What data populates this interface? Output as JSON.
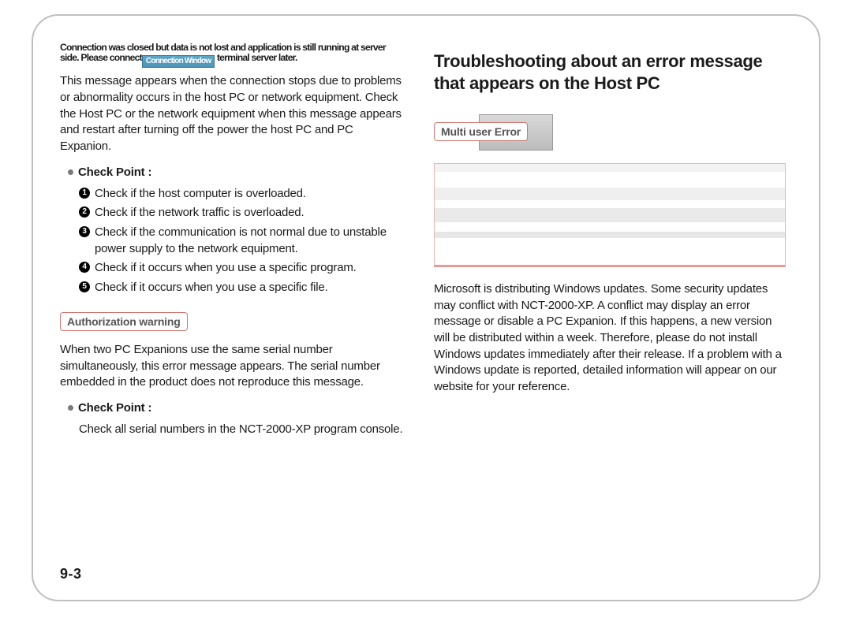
{
  "left": {
    "banner_text_a": "Connection was closed but data is not lost and application is still running at server side. Please connect",
    "banner_text_b": " terminal server later.",
    "banner_chip": "Connection Window",
    "intro": "This message appears when the connection stops due to problems or abnormality occurs in the host PC or network equipment. Check the Host PC or the network equipment when this message appears and restart after turning off the power the host PC and PC Expanion.",
    "cp_label": "Check Point :",
    "cp_items": [
      "Check if the host computer is overloaded.",
      "Check if the network traffic is overloaded.",
      "Check if the communication is not normal due to unstable power supply to the network equipment.",
      "Check if it occurs when you use a specific program.",
      "Check if it occurs when you use a specific file."
    ],
    "auth_tag": "Authorization warning",
    "auth_para": "When two PC Expanions use the same serial number simultaneously, this error message appears. The serial number embedded in the product does not reproduce this message.",
    "cp2_label": "Check Point :",
    "cp2_line": "Check all serial numbers in the NCT-2000-XP program console."
  },
  "right": {
    "title": "Troubleshooting about an error message that appears on the Host PC",
    "mu_tag": "Multi user Error",
    "mu_para": "Microsoft is distributing Windows updates. Some security updates may conflict with NCT-2000-XP. A conflict may display an error message or disable a PC Expanion. If this happens, a new version will be distributed within a week. Therefore, please do not install Windows updates immediately after their release. If a problem with a Windows update is reported, detailed information will appear on our website for your reference."
  },
  "page_number": "9-3"
}
